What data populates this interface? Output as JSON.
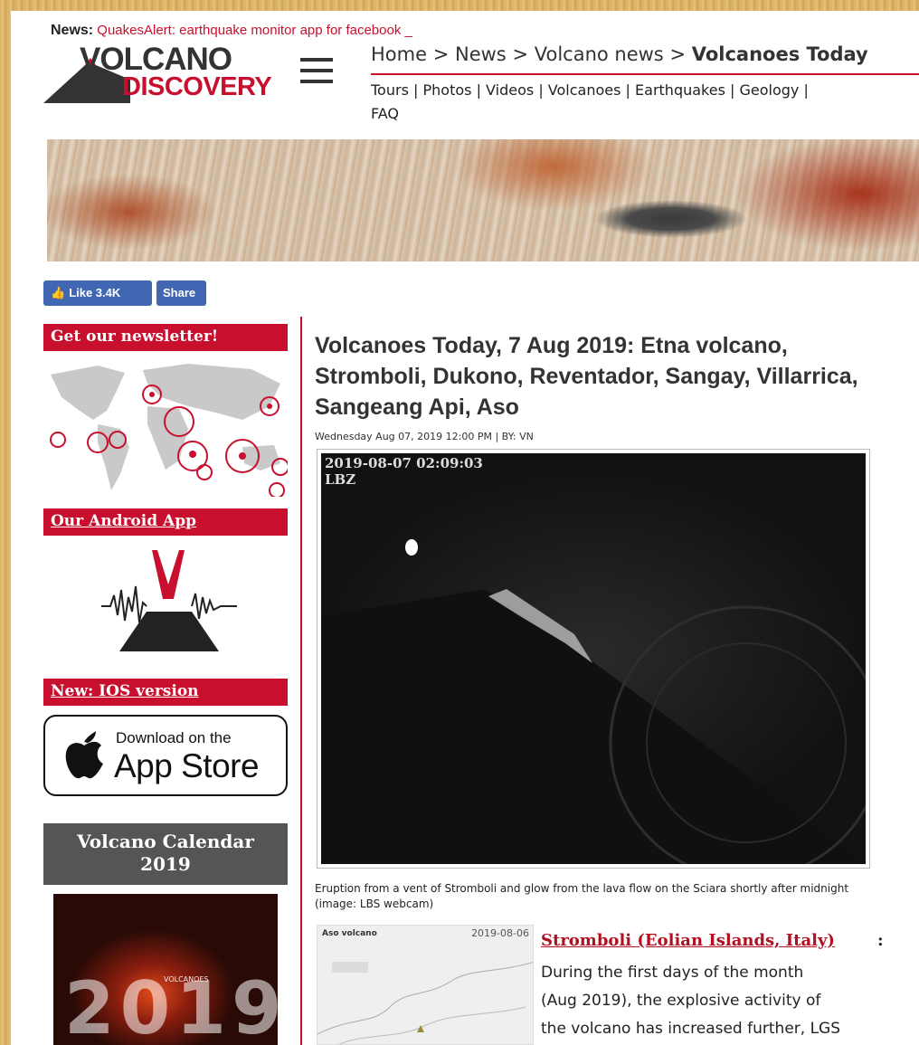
{
  "header": {
    "news_label": "News:",
    "news_text": "QuakesAlert: earthquake monitor app for facebook _",
    "logo_top": "VOLCANO",
    "logo_bottom": "DISCOVERY",
    "breadcrumb": [
      "Home",
      "News",
      "Volcano news"
    ],
    "breadcrumb_current": "Volcanoes Today",
    "breadcrumb_sep": ">",
    "nav": [
      "Tours",
      "Photos",
      "Videos",
      "Volcanoes",
      "Earthquakes",
      "Geology",
      "FAQ"
    ],
    "nav_sep": "|"
  },
  "social": {
    "like_label": "Like 3.4K",
    "share_label": "Share"
  },
  "sidebar": {
    "newsletter": "Get our newsletter!",
    "android": "Our Android App",
    "ios": "New: IOS version",
    "appstore_small": "Download on the",
    "appstore_big": "App Store",
    "calendar_line1": "Volcano Calendar",
    "calendar_line2": "2019",
    "calendar_year": "2019",
    "calendar_small": "VOLCANOES"
  },
  "article": {
    "title": "Volcanoes Today, 7 Aug 2019: Etna volcano, Stromboli, Dukono, Reventador, Sangay, Villarrica, Sangeang Api, Aso",
    "meta": "Wednesday Aug 07, 2019 12:00 PM | BY: VN",
    "webcam_timestamp": "2019-08-07 02:09:03",
    "webcam_station": "LBZ",
    "caption": "Eruption from a vent of Stromboli and glow from the lava flow on the Sciara shortly after midnight (image: LBS webcam)",
    "thumb_label": "Aso volcano",
    "thumb_date": "2019-08-06",
    "section_heading": "Stromboli (Eolian Islands, Italy)",
    "section_colon": ":",
    "body_lines": [
      "During the first days of the month",
      "(Aug 2019), the explosive activity of",
      "the volcano has increased further, LGS"
    ]
  },
  "colors": {
    "accent": "#c8102e",
    "facebook": "#4267b2",
    "background": "#e2bb70"
  }
}
